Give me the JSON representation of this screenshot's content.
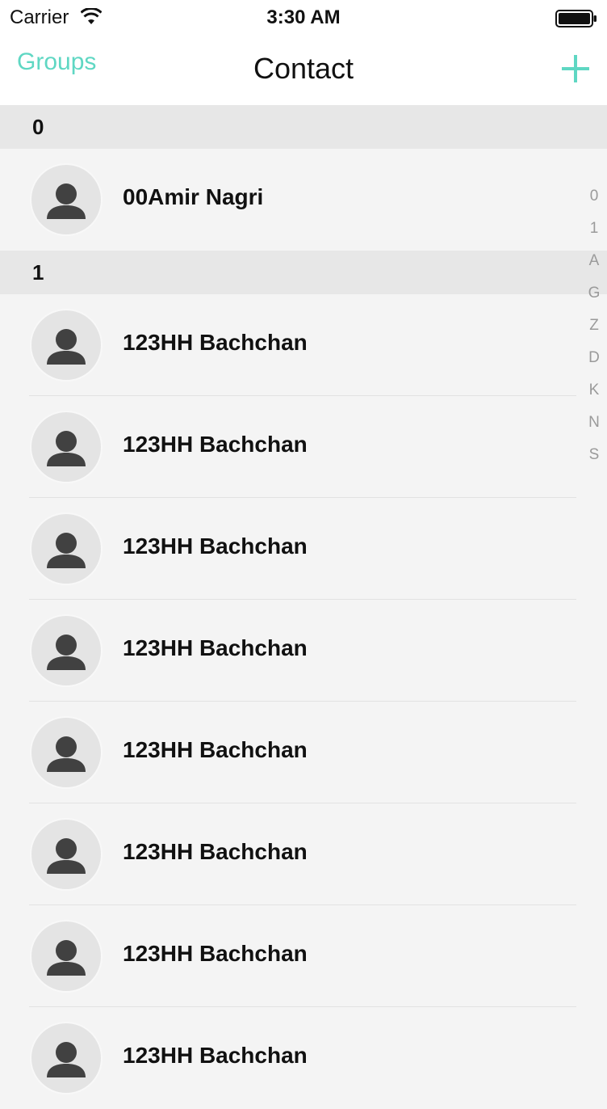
{
  "status": {
    "carrier": "Carrier",
    "time": "3:30 AM"
  },
  "nav": {
    "left_label": "Groups",
    "title": "Contact",
    "accent": "#5fd7c3"
  },
  "sections": [
    {
      "title": "0",
      "contacts": [
        "00Amir Nagri"
      ]
    },
    {
      "title": "1",
      "contacts": [
        "123HH Bachchan",
        "123HH Bachchan",
        "123HH Bachchan",
        "123HH Bachchan",
        "123HH Bachchan",
        "123HH Bachchan",
        "123HH Bachchan",
        "123HH Bachchan"
      ]
    }
  ],
  "index": [
    "0",
    "1",
    "A",
    "G",
    "Z",
    "D",
    "K",
    "N",
    "S"
  ],
  "icons": {
    "wifi": "wifi-icon",
    "battery": "battery-icon",
    "add": "plus-icon",
    "avatar": "person-icon"
  }
}
